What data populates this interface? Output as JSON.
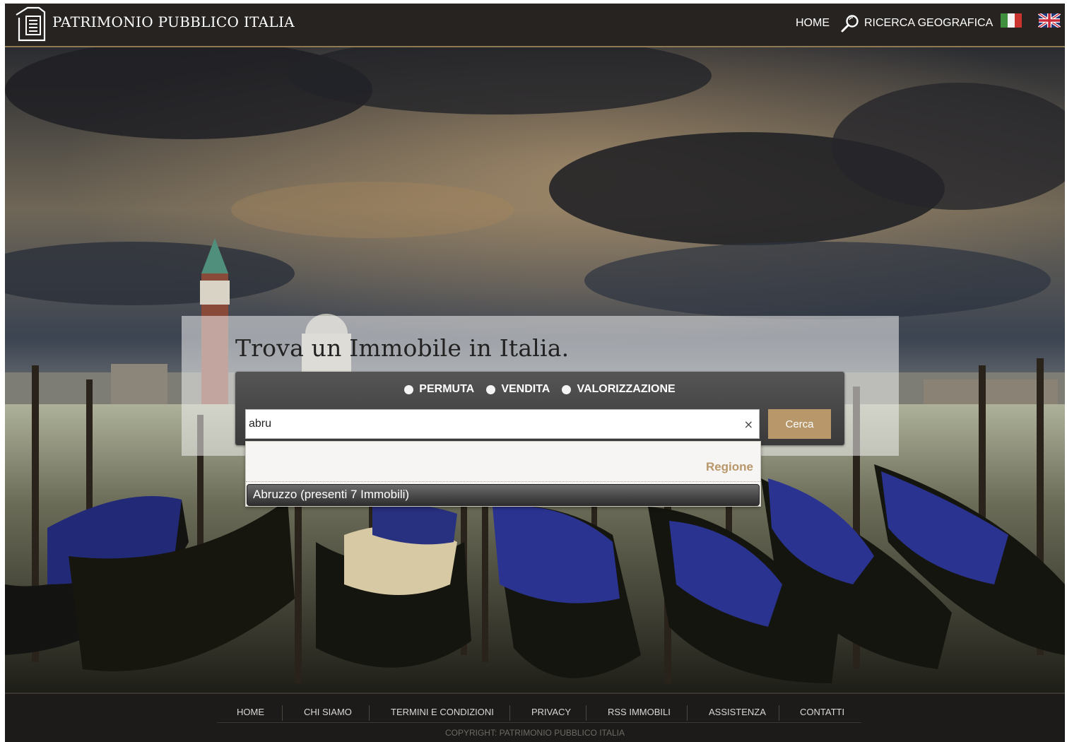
{
  "header": {
    "brand": "PATRIMONIO PUBBLICO ITALIA",
    "nav": {
      "home": "HOME",
      "geo_search": "RICERCA GEOGRAFICA"
    },
    "icons": [
      "document-logo-icon",
      "search-icon",
      "italy-flag-icon",
      "uk-flag-icon"
    ]
  },
  "search": {
    "title": "Trova un Immobile in Italia.",
    "options": [
      {
        "label": "PERMUTA"
      },
      {
        "label": "VENDITA"
      },
      {
        "label": "VALORIZZAZIONE"
      }
    ],
    "query": "abru",
    "clear_glyph": "×",
    "button": "Cerca"
  },
  "autocomplete": {
    "group_header": "Regione",
    "items": [
      {
        "label": "Abruzzo (presenti 7 Immobili)"
      }
    ]
  },
  "footer": {
    "links": [
      {
        "label": "HOME"
      },
      {
        "label": "CHI SIAMO"
      },
      {
        "label": "TERMINI E CONDIZIONI"
      },
      {
        "label": "PRIVACY"
      },
      {
        "label": "RSS IMMOBILI"
      },
      {
        "label": "ASSISTENZA"
      },
      {
        "label": "CONTATTI"
      }
    ],
    "copyright": "COPYRIGHT: PATRIMONIO PUBBLICO ITALIA"
  },
  "colors": {
    "header_bg": "#262321",
    "accent_gold": "#b8976a",
    "footer_bg": "#1c1b1a"
  }
}
